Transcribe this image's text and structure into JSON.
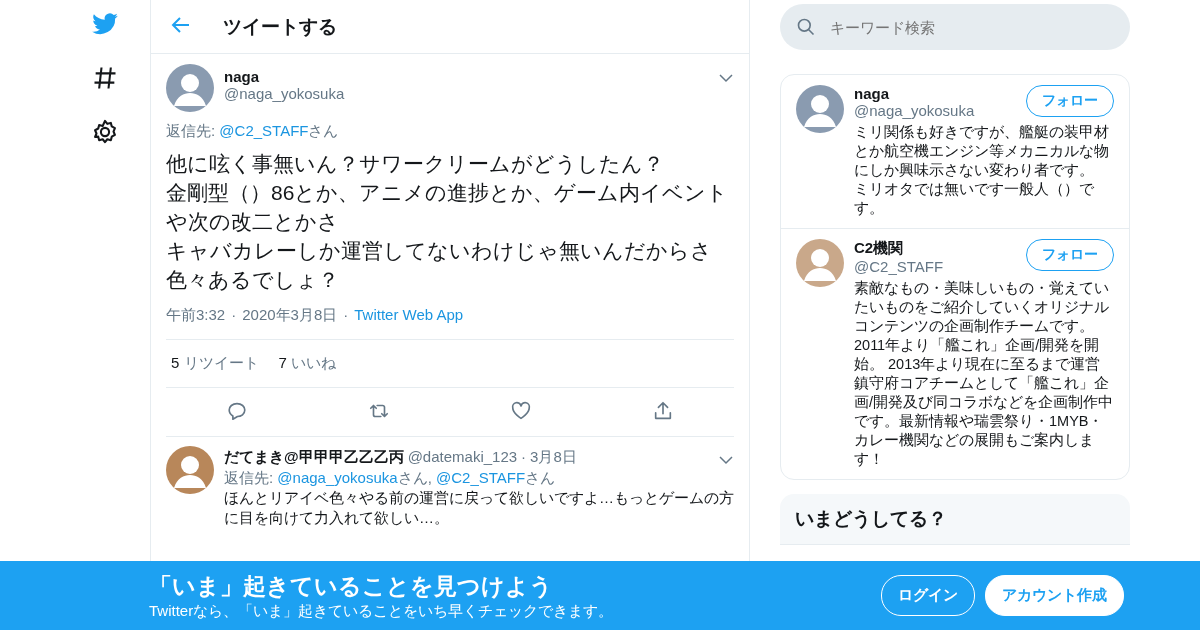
{
  "header": {
    "title": "ツイートする"
  },
  "tweet": {
    "name": "naga",
    "handle": "@naga_yokosuka",
    "reply": {
      "prefix": "返信先: ",
      "mentions": [
        {
          "handle": "@C2_STAFF",
          "suffix": "さん"
        }
      ]
    },
    "text": [
      "他に呟く事無いん？サワークリームがどうしたん？",
      "金剛型（）86とか、アニメの進捗とか、ゲーム内イベントや次の改二とかさ",
      "キャバカレーしか運営してないわけじゃ無いんだからさ色々あるでしょ？"
    ],
    "time": "午前3:32",
    "separator": "·",
    "date": "2020年3月8日",
    "source": "Twitter Web App",
    "stats": [
      {
        "count": "5",
        "label": "リツイート"
      },
      {
        "count": "7",
        "label": "いいね"
      }
    ]
  },
  "replies": [
    {
      "name": "だてまき@甲甲甲乙乙乙丙",
      "handle": "@datemaki_123",
      "separator": "·",
      "date": "3月8日",
      "reply": {
        "prefix": "返信先: ",
        "joiner": ", ",
        "mentions": [
          {
            "handle": "@naga_yokosuka",
            "suffix": "さん"
          },
          {
            "handle": "@C2_STAFF",
            "suffix": "さん"
          }
        ]
      },
      "text": "ほんとリアイベ色々やる前の運営に戻って欲しいですよ…もっとゲームの方に目を向けて力入れて欲しい…。"
    }
  ],
  "search": {
    "placeholder": "キーワード検索"
  },
  "related_accounts": [
    {
      "name": "naga",
      "handle": "@naga_yokosuka",
      "follow": "フォロー",
      "bio": [
        "ミリ関係も好きですが、艦艇の装甲材とか航空機エンジン等メカニカルな物にしか興味示さない変わり者です。",
        "ミリオタでは無いです一般人（）です。"
      ]
    },
    {
      "name": "C2機関",
      "handle": "@C2_STAFF",
      "follow": "フォロー",
      "bio": [
        "素敵なもの・美味しいもの・覚えていたいものをご紹介していくオリジナルコンテンツの企画制作チームです。2011年より「艦これ」企画/開発を開始。 2013年より現在に至るまで運営鎮守府コアチームとして「艦これ」企画/開発及び同コラボなどを企画制作中です。最新情報や瑞雲祭り・1MYB・カレー機関などの展開もご案内します！"
      ]
    }
  ],
  "trends": {
    "title": "いまどうしてる？"
  },
  "banner": {
    "title": "「いま」起きていることを見つけよう",
    "subtitle": "Twitterなら、「いま」起きていることをいち早くチェックできます。",
    "login": "ログイン",
    "signup": "アカウント作成"
  }
}
